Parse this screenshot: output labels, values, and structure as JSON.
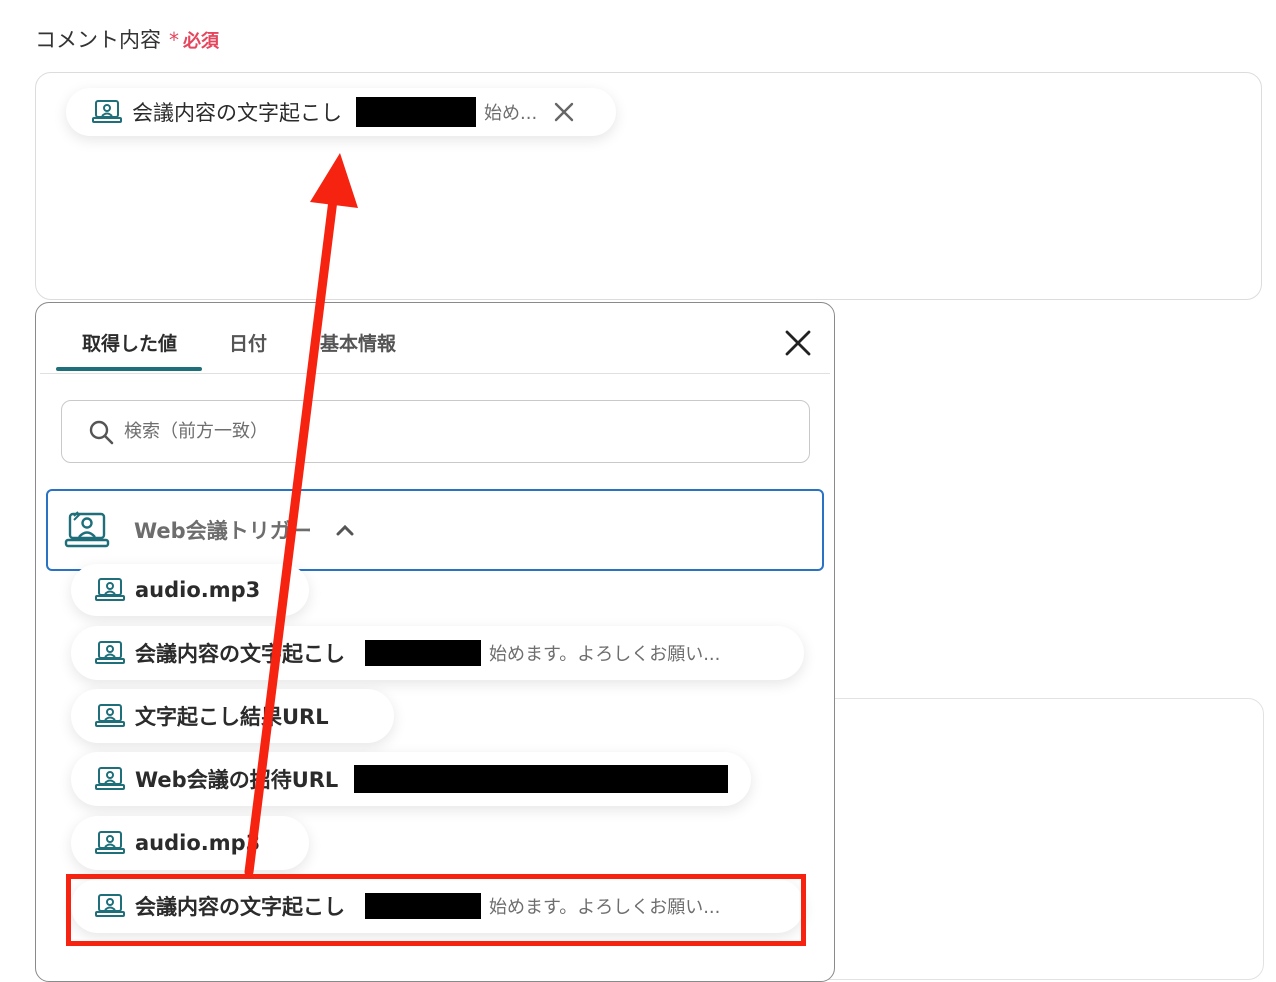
{
  "field": {
    "label": "コメント内容",
    "required_star": "*",
    "required_text": "必須"
  },
  "chip": {
    "title": "会議内容の文字起こし",
    "preview": "始め...",
    "close_icon": "close-icon"
  },
  "popup": {
    "tabs": [
      {
        "label": "取得した値",
        "active": true
      },
      {
        "label": "日付",
        "active": false
      },
      {
        "label": "基本情報",
        "active": false
      }
    ],
    "close_icon": "close-icon",
    "search": {
      "placeholder": "検索（前方一致）",
      "value": ""
    },
    "trigger": {
      "label": "Web会議トリガー",
      "expanded": true
    },
    "items": [
      {
        "title": "audio.mp3",
        "preview": ""
      },
      {
        "title": "会議内容の文字起こし",
        "preview": "始めます。よろしくお願い..."
      },
      {
        "title": "文字起こし結果URL",
        "preview": ""
      },
      {
        "title": "Web会議の招待URL",
        "preview": ""
      },
      {
        "title": "audio.mp3",
        "preview": ""
      },
      {
        "title": "会議内容の文字起こし",
        "preview": "始めます。よろしくお願い..."
      }
    ]
  },
  "colors": {
    "accent": "#1f6f7a",
    "required": "#e5455d",
    "annotation": "#f5230f",
    "trigger_border": "#2a73c4"
  }
}
